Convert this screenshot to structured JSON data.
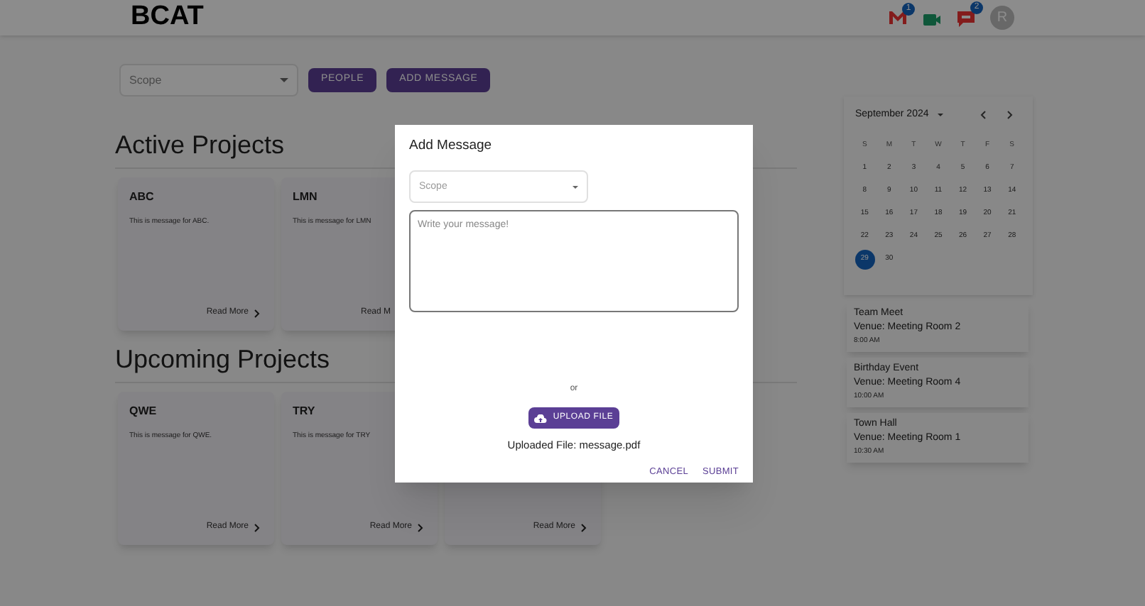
{
  "header": {
    "logo": "BCAT",
    "notifications": [
      {
        "kind": "mail",
        "badge": "1"
      },
      {
        "kind": "video"
      },
      {
        "kind": "chat",
        "badge": "2"
      }
    ],
    "avatar": "R"
  },
  "toolbar": {
    "scope": {
      "placeholder": "Scope"
    },
    "buttons": [
      "PEOPLE",
      "ADD MESSAGE"
    ]
  },
  "sections": [
    {
      "title": "Active Projects",
      "cards": [
        {
          "title": "ABC",
          "message": "This is message for ABC.",
          "read_more": "Read More",
          "chevron": true
        },
        {
          "title": "LMN",
          "message": "This is message for LMN",
          "read_more": "Read M",
          "chevron": false
        }
      ]
    },
    {
      "title": "Upcoming Projects",
      "cards": [
        {
          "title": "QWE",
          "message": "This is message for QWE.",
          "read_more": "Read More",
          "chevron": true
        },
        {
          "title": "TRY",
          "message": "This is message for TRY",
          "read_more": "Read More",
          "chevron": true
        },
        {
          "read_more": "Read More",
          "chevron": true
        }
      ]
    }
  ],
  "calendar": {
    "month": "September 2024",
    "weekdays": [
      "S",
      "M",
      "T",
      "W",
      "T",
      "F",
      "S"
    ],
    "days": [
      {
        "label": "1",
        "selected": false
      },
      {
        "label": "2",
        "selected": false
      },
      {
        "label": "3",
        "selected": false
      },
      {
        "label": "4",
        "selected": false
      },
      {
        "label": "5",
        "selected": false
      },
      {
        "label": "6",
        "selected": false
      },
      {
        "label": "7",
        "selected": false
      },
      {
        "label": "8",
        "selected": false
      },
      {
        "label": "9",
        "selected": false
      },
      {
        "label": "10",
        "selected": false
      },
      {
        "label": "11",
        "selected": false
      },
      {
        "label": "12",
        "selected": false
      },
      {
        "label": "13",
        "selected": false
      },
      {
        "label": "14",
        "selected": false
      },
      {
        "label": "15",
        "selected": false
      },
      {
        "label": "16",
        "selected": false
      },
      {
        "label": "17",
        "selected": false
      },
      {
        "label": "18",
        "selected": false
      },
      {
        "label": "19",
        "selected": false
      },
      {
        "label": "20",
        "selected": false
      },
      {
        "label": "21",
        "selected": false
      },
      {
        "label": "22",
        "selected": false
      },
      {
        "label": "23",
        "selected": false
      },
      {
        "label": "24",
        "selected": false
      },
      {
        "label": "25",
        "selected": false
      },
      {
        "label": "26",
        "selected": false
      },
      {
        "label": "27",
        "selected": false
      },
      {
        "label": "28",
        "selected": false
      },
      {
        "label": "29",
        "selected": true
      },
      {
        "label": "30",
        "selected": false
      }
    ]
  },
  "events": [
    {
      "title": "Team Meet",
      "venue": "Venue: Meeting Room 2",
      "time": "8:00 AM"
    },
    {
      "title": "Birthday Event",
      "venue": "Venue: Meeting Room 4",
      "time": "10:00 AM"
    },
    {
      "title": "Town Hall",
      "venue": "Venue: Meeting Room 1",
      "time": "10:30 AM"
    }
  ],
  "dialog": {
    "title": "Add Message",
    "scope": {
      "placeholder": "Scope"
    },
    "message": {
      "placeholder": "Write your message!"
    },
    "or": "or",
    "upload_button": "UPLOAD FILE",
    "uploaded": "Uploaded File: message.pdf",
    "actions": [
      "CANCEL",
      "SUBMIT"
    ]
  }
}
